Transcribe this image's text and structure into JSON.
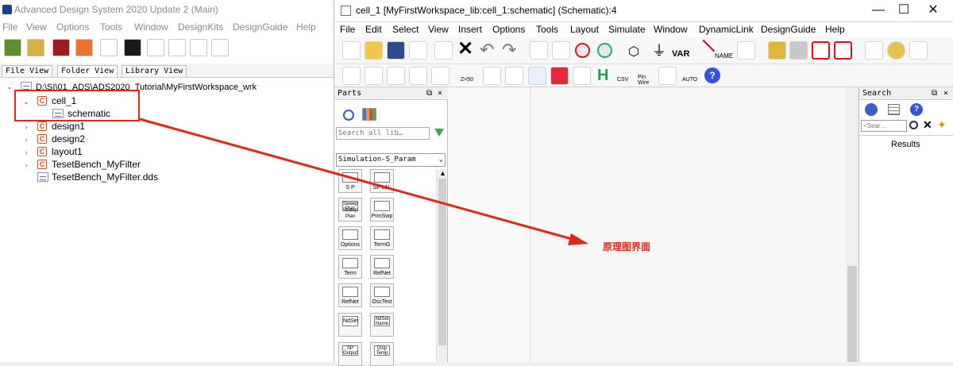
{
  "main": {
    "window_title": "Advanced Design System 2020 Update 2 (Main)",
    "menu": [
      "File",
      "View",
      "Options",
      "Tools",
      "Window",
      "DesignKits",
      "DesignGuide",
      "Help"
    ],
    "tabs": [
      "File View",
      "Folder View",
      "Library View"
    ],
    "tree": {
      "root": "D:\\SI\\01_ADS\\ADS2020_Tutorial\\MyFirstWorkspace_wrk",
      "items": [
        {
          "label": "cell_1",
          "expanded": true
        },
        {
          "label": "schematic",
          "child": true
        },
        {
          "label": "design1"
        },
        {
          "label": "design2"
        },
        {
          "label": "layout1"
        },
        {
          "label": "TesetBench_MyFilter"
        },
        {
          "label": "TesetBench_MyFilter.dds",
          "file": true
        }
      ]
    }
  },
  "schematic": {
    "window_title": "cell_1 [MyFirstWorkspace_lib:cell_1:schematic] (Schematic):4",
    "menu": [
      "File",
      "Edit",
      "Select",
      "View",
      "Insert",
      "Options",
      "Tools",
      "Layout",
      "Simulate",
      "Window",
      "DynamicLink",
      "DesignGuide",
      "Help"
    ],
    "toolbar_labels": {
      "var": "VAR",
      "name": "NAME",
      "zref": "Z=50",
      "csv": "CSV",
      "pin": "Pin",
      "wire": "Wire",
      "auto": "AUTO",
      "label_h": "H"
    },
    "parts": {
      "title": "Parts",
      "search_placeholder": "Search all lib…",
      "library": "Simulation-S_Param",
      "items": [
        {
          "icon": "sp-icon",
          "label": "S P"
        },
        {
          "icon": "sp-lsp-icon",
          "label": "SP L1L"
        },
        {
          "icon": "sweep-plan-icon",
          "label": "Sweep Plan",
          "inner": "Sweep\nPlan"
        },
        {
          "icon": "param-sweep-icon",
          "label": "PrmSwp"
        },
        {
          "icon": "options-icon",
          "label": "Options"
        },
        {
          "icon": "termg-icon",
          "label": "TermG"
        },
        {
          "icon": "term-icon",
          "label": "Term"
        },
        {
          "icon": "refnet-icon",
          "label": "RefNet"
        },
        {
          "icon": "refnet2-icon",
          "label": "RefNet"
        },
        {
          "icon": "osctest-icon",
          "label": "OscTest"
        },
        {
          "icon": "ndset-icon",
          "label": "",
          "inner": "NdSet"
        },
        {
          "icon": "ndset-name-icon",
          "label": "",
          "inner": "NdSet\nName"
        },
        {
          "icon": "sp-output-icon",
          "label": "",
          "inner": "SP\nOutput"
        },
        {
          "icon": "disp-temp-icon",
          "label": "",
          "inner": "Disp\nTemp"
        }
      ]
    },
    "search": {
      "title": "Search",
      "input_placeholder": "<Sear…",
      "results_label": "Results"
    },
    "window_controls": [
      "—",
      "☐",
      "✕"
    ]
  },
  "annotation": {
    "label": "原理图界面",
    "color": "#e0281b"
  }
}
